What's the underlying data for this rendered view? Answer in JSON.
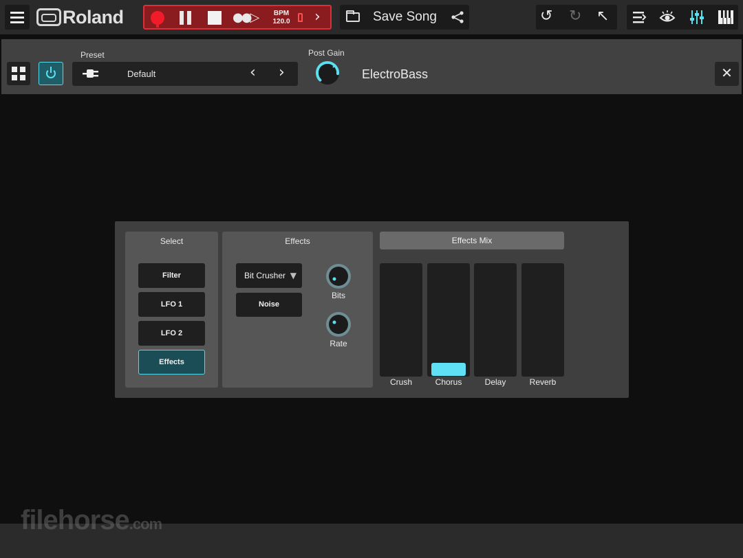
{
  "app": {
    "brand": "Roland"
  },
  "transport": {
    "bpm_label": "BPM",
    "bpm_value": "120.0"
  },
  "song": {
    "title": "Save Song"
  },
  "instrument": {
    "preset_label": "Preset",
    "preset_name": "Default",
    "post_gain_label": "Post Gain",
    "post_gain_level": 0.85,
    "name": "ElectroBass"
  },
  "panel": {
    "select": {
      "title": "Select",
      "items": [
        "Filter",
        "LFO 1",
        "LFO 2",
        "Effects"
      ],
      "active": "Effects"
    },
    "effects": {
      "title": "Effects",
      "effect_type": "Bit Crusher",
      "noise_label": "Noise",
      "bits_label": "Bits",
      "rate_label": "Rate"
    },
    "effects_mix": {
      "title": "Effects Mix",
      "channels": [
        {
          "label": "Crush",
          "level": null
        },
        {
          "label": "Chorus",
          "level": 0.0
        },
        {
          "label": "Delay",
          "level": null
        },
        {
          "label": "Reverb",
          "level": null
        }
      ]
    }
  },
  "watermark": {
    "text": "filehorse",
    "suffix": ".com"
  },
  "colors": {
    "accent": "#5be0f2",
    "record": "#f01c2a",
    "transport_bg": "#8a1b1f"
  }
}
